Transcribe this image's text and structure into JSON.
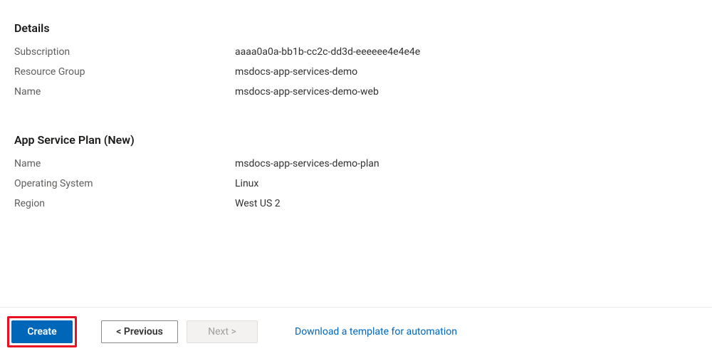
{
  "details": {
    "heading": "Details",
    "rows": [
      {
        "label": "Subscription",
        "value": "aaaa0a0a-bb1b-cc2c-dd3d-eeeeee4e4e4e"
      },
      {
        "label": "Resource Group",
        "value": "msdocs-app-services-demo"
      },
      {
        "label": "Name",
        "value": "msdocs-app-services-demo-web"
      }
    ]
  },
  "plan": {
    "heading": "App Service Plan (New)",
    "rows": [
      {
        "label": "Name",
        "value": "msdocs-app-services-demo-plan"
      },
      {
        "label": "Operating System",
        "value": "Linux"
      },
      {
        "label": "Region",
        "value": "West US 2"
      }
    ]
  },
  "footer": {
    "create": "Create",
    "previous": "< Previous",
    "next": "Next >",
    "download_link": "Download a template for automation"
  }
}
